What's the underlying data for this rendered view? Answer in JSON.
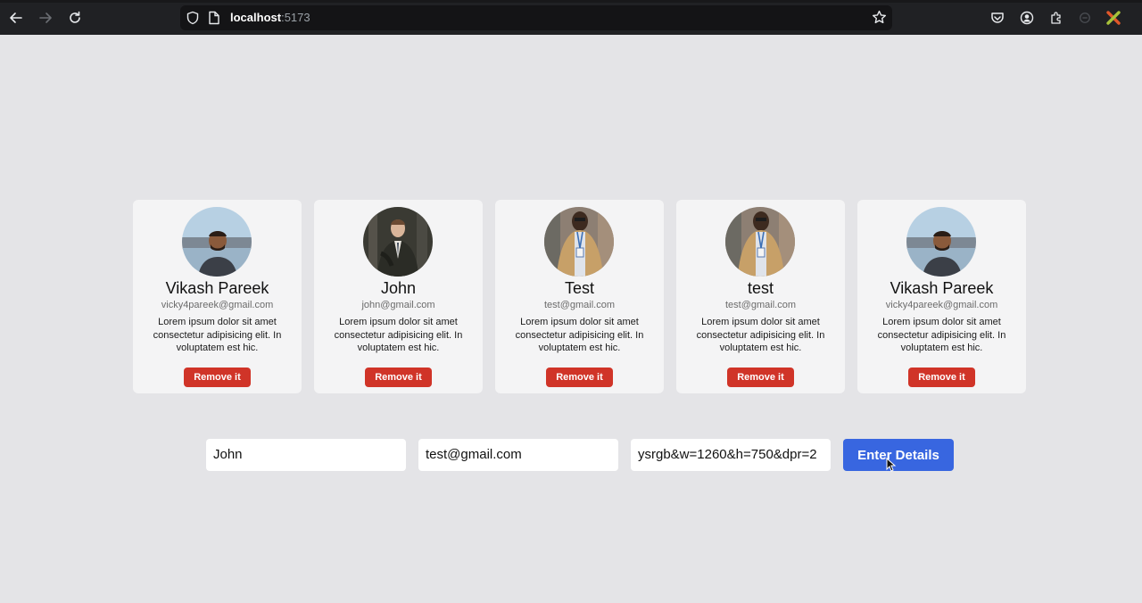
{
  "browser": {
    "url_host": "localhost",
    "url_port": ":5173",
    "icons": [
      "back-arrow-icon",
      "forward-arrow-icon",
      "reload-icon",
      "shield-icon",
      "page-icon",
      "star-icon",
      "pocket-icon",
      "account-icon",
      "extensions-icon",
      "extension-icon"
    ]
  },
  "cards": [
    {
      "name": "Vikash Pareek",
      "email": "vicky4pareek@gmail.com",
      "description": "Lorem ipsum dolor sit amet consectetur adipisicing elit. In voluptatem est hic.",
      "button": "Remove it"
    },
    {
      "name": "John",
      "email": "john@gmail.com",
      "description": "Lorem ipsum dolor sit amet consectetur adipisicing elit. In voluptatem est hic.",
      "button": "Remove it"
    },
    {
      "name": "Test",
      "email": "test@gmail.com",
      "description": "Lorem ipsum dolor sit amet consectetur adipisicing elit. In voluptatem est hic.",
      "button": "Remove it"
    },
    {
      "name": "test",
      "email": "test@gmail.com",
      "description": "Lorem ipsum dolor sit amet consectetur adipisicing elit. In voluptatem est hic.",
      "button": "Remove it"
    },
    {
      "name": "Vikash Pareek",
      "email": "vicky4pareek@gmail.com",
      "description": "Lorem ipsum dolor sit amet consectetur adipisicing elit. In voluptatem est hic.",
      "button": "Remove it"
    }
  ],
  "form": {
    "name_value": "John",
    "email_value": "test@gmail.com",
    "image_value": "ysrgb&w=1260&h=750&dpr=2",
    "submit_label": "Enter Details"
  },
  "colors": {
    "page_bg": "#e4e4e7",
    "card_bg": "#f4f4f5",
    "remove_button": "#d03428",
    "submit_button": "#3866e0"
  }
}
